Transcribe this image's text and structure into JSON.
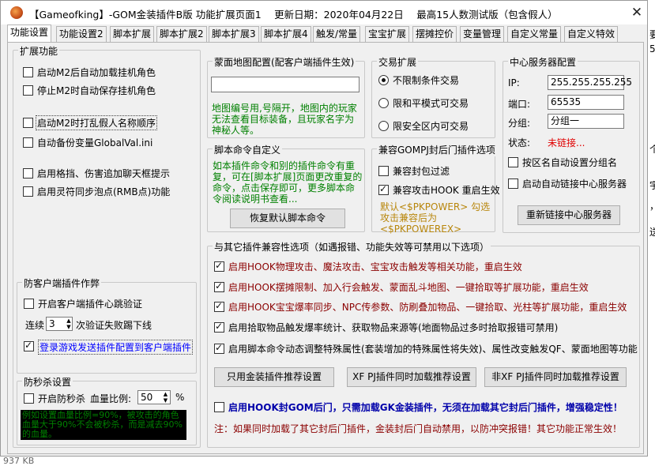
{
  "title": "【Gameofking】-GOM金装插件B版 功能扩展页面1　  更新日期：2020年04月22日　  最高15人数测试版（包含假人）",
  "close_symbol": "✕",
  "tabs": [
    "功能设置",
    "功能设置2",
    "脚本扩展",
    "脚本扩展2",
    "脚本扩展3",
    "脚本扩展4",
    "触发/常量",
    "宝宝扩展",
    "摆摊控价",
    "变量管理",
    "自定义常量",
    "自定义特效"
  ],
  "ext": {
    "label": "扩展功能",
    "items": [
      {
        "label": "启动M2后自动加载挂机角色",
        "checked": false
      },
      {
        "label": "停止M2时自动保存挂机角色",
        "checked": false
      },
      {
        "label": "启动M2时打乱假人名称顺序",
        "checked": false
      },
      {
        "label": "自动备份变量GlobalVal.ini",
        "checked": false
      },
      {
        "label": "启用格挡、伤害追加聊天框提示",
        "checked": false
      },
      {
        "label": "启用灵符同步泡点(RMB点)功能",
        "checked": false
      }
    ]
  },
  "client": {
    "label": "防客户端插件作弊",
    "heartbeat": "开启客户端插件心跳验证",
    "cont": "连续",
    "count": "3",
    "fail_text": "次验证失败踢下线",
    "send_login": "登录游戏发送插件配置到客户端插件"
  },
  "instakill": {
    "label": "防秒杀设置",
    "enable": "开启防秒杀",
    "ratio_label": "血量比例:",
    "ratio_value": "50",
    "percent": "%",
    "info": "例如设置血量比例=90%，被攻击的角色血量大于90%不会被秒杀，而是减去90%的血量。"
  },
  "map": {
    "label": "蒙面地图配置(配客户端插件生效)",
    "input": "",
    "info": "地图编号用,号隔开，地图内的玩家无法查看目标装备，且玩家名字为神秘人等。"
  },
  "trade": {
    "label": "交易扩展",
    "options": [
      {
        "label": "不限制条件交易",
        "checked": true
      },
      {
        "label": "限和平模式可交易",
        "checked": false
      },
      {
        "label": "限安全区内可交易",
        "checked": false
      }
    ]
  },
  "server": {
    "label": "中心服务器配置",
    "ip_label": "IP:",
    "ip": "255.255.255.255",
    "port_label": "端口:",
    "port": "65535",
    "group_label": "分组:",
    "group": "分组一",
    "status_label": "状态:",
    "status": "未链接...",
    "auto_group": "按区名自动设置分组名",
    "auto_link": "启动自动链接中心服务器",
    "reconnect": "重新链接中心服务器"
  },
  "script": {
    "label": "脚本命令自定义",
    "info": "如本插件命令和别的插件命令有重复，可在[脚本扩展]页面更改重复的命令，点击保存即可，更多脚本命令阅读说明书查看...",
    "reset": "恢复默认脚本命令"
  },
  "gompj": {
    "label": "兼容GOMPJ封后门插件选项",
    "items": [
      {
        "label": "兼容封包过滤",
        "checked": false
      },
      {
        "label": "兼容攻击HOOK 重启生效",
        "checked": true
      }
    ],
    "info": "默认<$PKPOWER> 勾选攻击兼容后为<$PKPOWEREX>"
  },
  "compat": {
    "label": "与其它插件兼容性选项（如遇报错、功能失效等可禁用以下选项）",
    "items": [
      {
        "label": "启用HOOK物理攻击、魔法攻击、宝宝攻击触发等相关功能，重启生效",
        "checked": true,
        "color": "darkred"
      },
      {
        "label": "启用HOOK摆摊限制、加入行会触发、蒙面乱斗地图、一键拾取等扩展功能，重启生效",
        "checked": true,
        "color": "darkred"
      },
      {
        "label": "启用HOOK宝宝爆率同步、NPC传参数、防刷叠加物品、一键拾取、光柱等扩展功能，重启生效",
        "checked": true,
        "color": "darkred"
      },
      {
        "label": "启用拾取物品触发爆率统计、获取物品来源等(地面物品过多时拾取报错可禁用)",
        "checked": true,
        "color": "black"
      },
      {
        "label": "启用脚本命令动态调整特殊属性(套装增加的特殊属性将失效)、属性改变触发QF、蒙面地图等功能",
        "checked": true,
        "color": "black"
      }
    ],
    "btn1": "只用金装插件推荐设置",
    "btn2": "XF PJ插件同时加载推荐设置",
    "btn3": "非XF PJ插件同时加载推荐设置",
    "hook_gom": "启用HOOK封GOM后门，只需加载GK金装插件，无须在加载其它封后门插件，增强稳定性！",
    "note": "注：如果同时加载了其它封后门插件，金装封后门自动禁用，以防冲突报错！其它功能正常生效！"
  },
  "background": {
    "file_size": "937 KB",
    "side_fragments": [
      "要",
      "5",
      "个",
      "宇",
      "，",
      "送"
    ]
  }
}
